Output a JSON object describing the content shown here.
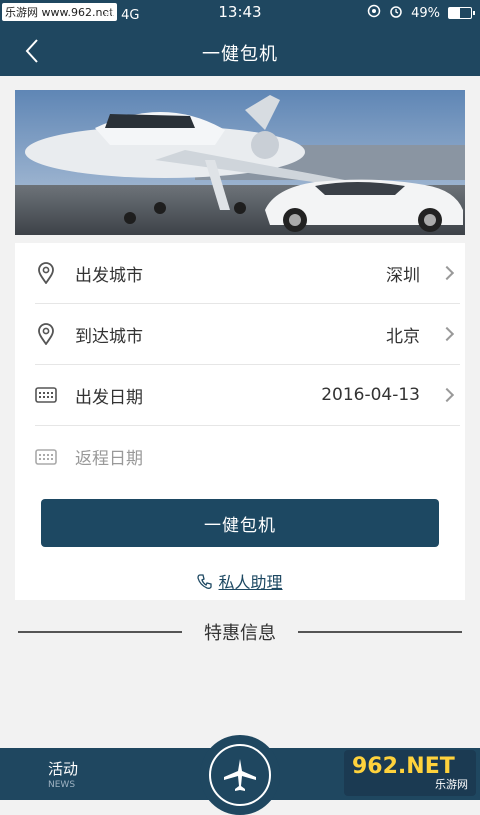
{
  "status": {
    "watermark": "乐游网 www.962.net",
    "carrier": "动 4G",
    "time": "13:43",
    "battery": "49%",
    "battery_level": 0.49
  },
  "nav": {
    "back_icon": "chevron-left-icon",
    "title": "一健包机"
  },
  "form": {
    "rows": [
      {
        "icon": "location-pin-icon",
        "label": "出发城市",
        "value": "深圳"
      },
      {
        "icon": "location-pin-icon",
        "label": "到达城市",
        "value": "北京"
      },
      {
        "icon": "calendar-icon",
        "label": "出发日期",
        "value": "2016-04-13"
      },
      {
        "icon": "calendar-icon",
        "label": "返程日期",
        "value": ""
      }
    ],
    "submit_label": "一健包机",
    "assistant_label": "私人助理"
  },
  "section": {
    "title": "特惠信息"
  },
  "tabbar": {
    "tab_label": "活动",
    "tab_sub": "NEWS",
    "center_icon": "airplane-icon"
  },
  "logo": {
    "text": "962.NET",
    "subtext": "乐游网"
  },
  "colors": {
    "brand": "#1f4760",
    "button": "#1d4862"
  }
}
